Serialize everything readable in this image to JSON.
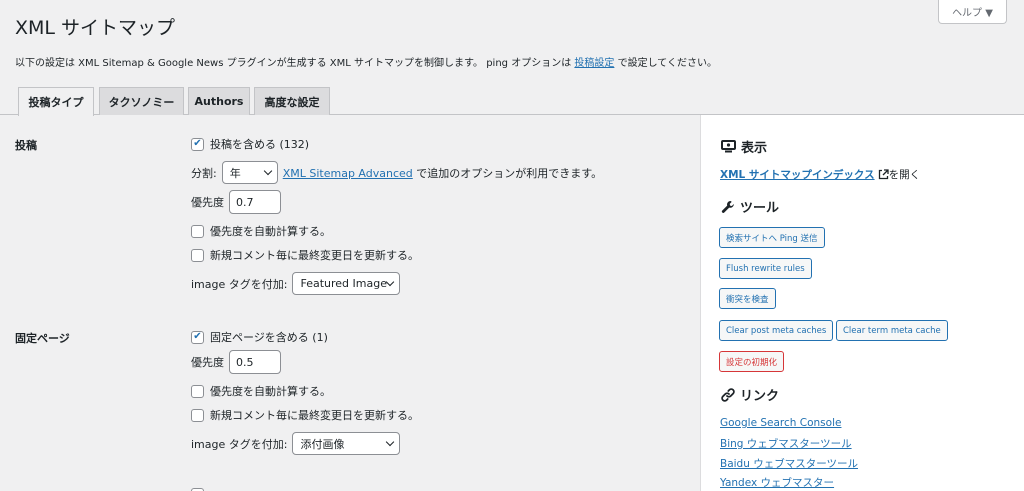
{
  "header": {
    "help_label": "ヘルプ ▼",
    "title": "XML サイトマップ",
    "intro_before": "以下の設定は XML Sitemap & Google News プラグインが生成する XML サイトマップを制御します。 ping オプションは ",
    "intro_link": "投稿設定",
    "intro_after": " で設定してください。"
  },
  "tabs": [
    {
      "label": "投稿タイプ",
      "active": true
    },
    {
      "label": "タクソノミー",
      "active": false
    },
    {
      "label": "Authors",
      "active": false
    },
    {
      "label": "高度な設定",
      "active": false
    }
  ],
  "posts": {
    "label": "投稿",
    "include_label": "投稿を含める (132)",
    "include_checked": true,
    "split_label": "分割:",
    "split_value": "年",
    "advanced_link": "XML Sitemap Advanced",
    "advanced_after": " で追加のオプションが利用できます。",
    "priority_label": "優先度",
    "priority_value": "0.7",
    "auto_priority_label": "優先度を自動計算する。",
    "comment_update_label": "新規コメント毎に最終変更日を更新する。",
    "image_tag_label": "image タグを付加:",
    "image_tag_value": "Featured Image"
  },
  "pages": {
    "label": "固定ページ",
    "include_label": "固定ページを含める (1)",
    "include_checked": true,
    "priority_label": "優先度",
    "priority_value": "0.5",
    "auto_priority_label": "優先度を自動計算する。",
    "comment_update_label": "新規コメント毎に最終変更日を更新する。",
    "image_tag_label": "image タグを付加:",
    "image_tag_value": "添付画像"
  },
  "sidebar": {
    "view_heading": "表示",
    "index_link": "XML サイトマップインデックス",
    "index_after": " を開く",
    "tools_heading": "ツール",
    "buttons": {
      "ping": "検索サイトへ Ping 送信",
      "flush": "Flush rewrite rules",
      "conflicts": "衝突を検査",
      "clear_post": "Clear post meta caches",
      "clear_term": "Clear term meta cache",
      "reset": "設定の初期化"
    },
    "links_heading": "リンク",
    "links": [
      "Google Search Console",
      "Bing ウェブマスターツール",
      "Baidu ウェブマスターツール",
      "Yandex ウェブマスター"
    ]
  },
  "colors": {
    "accent": "#2271b1",
    "danger": "#d63638",
    "background": "#f0f0f1"
  }
}
